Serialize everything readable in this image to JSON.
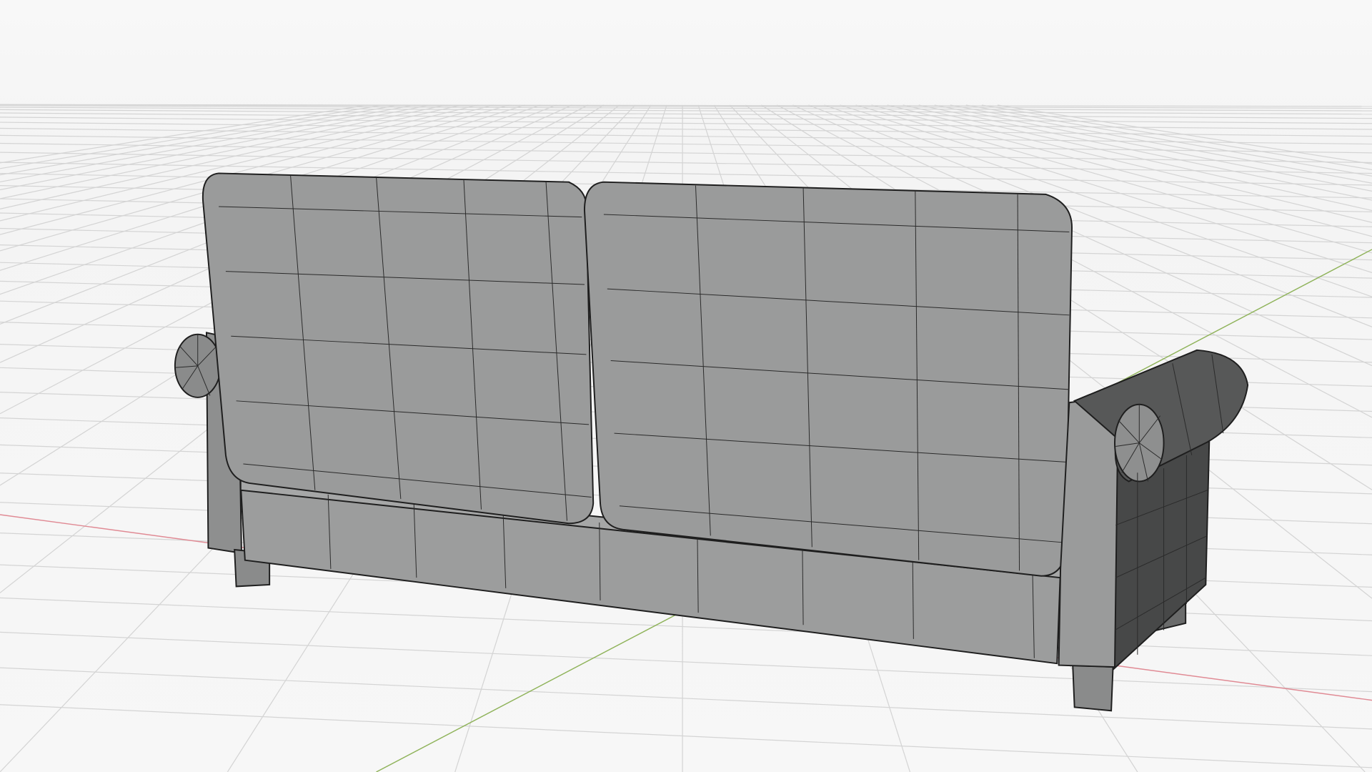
{
  "colors": {
    "background": "#f6f6f6",
    "grid": "#d4d4d4",
    "x_axis": "#e08a94",
    "y_axis": "#8fb35a",
    "mesh_light": "#9a9b9b",
    "mesh_mid": "#8c8d8d",
    "mesh_dark": "#4a4b4b",
    "wire": "#2a2a2a"
  }
}
